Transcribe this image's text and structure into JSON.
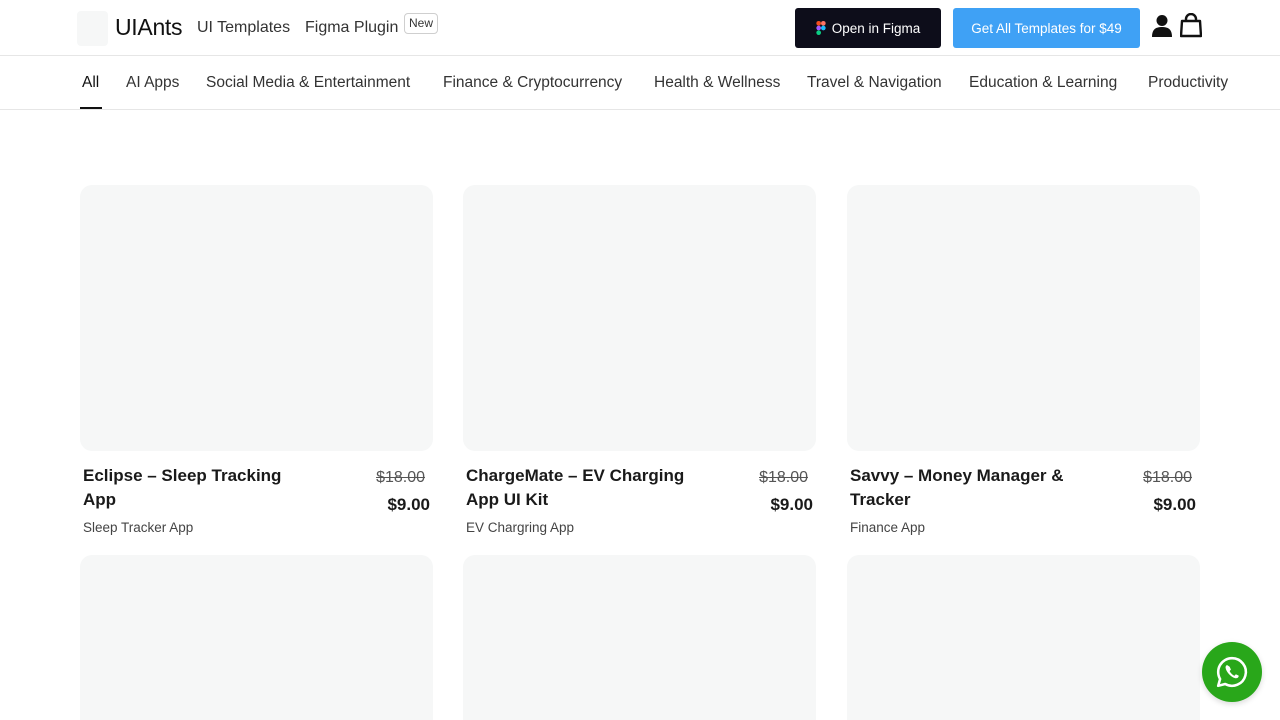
{
  "header": {
    "logo_text": "UIAnts",
    "nav_templates": "UI Templates",
    "nav_plugin": "Figma Plugin",
    "badge_new": "New",
    "btn_figma": "Open in Figma",
    "btn_all": "Get All Templates for $49"
  },
  "categories": [
    "All",
    "AI Apps",
    "Social Media & Entertainment",
    "Finance & Cryptocurrency",
    "Health & Wellness",
    "Travel & Navigation",
    "Education & Learning",
    "Productivity"
  ],
  "products": [
    {
      "title": "Eclipse – Sleep Tracking App",
      "old_price": "$18.00",
      "price": "$9.00",
      "category": "Sleep Tracker App"
    },
    {
      "title": "ChargeMate – EV Charging App UI Kit",
      "old_price": "$18.00",
      "price": "$9.00",
      "category": "EV Chargring App"
    },
    {
      "title": "Savvy – Money Manager & Tracker",
      "old_price": "$18.00",
      "price": "$9.00",
      "category": "Finance App"
    }
  ],
  "icons": {
    "figma": "figma-icon",
    "user": "user-icon",
    "cart": "shopping-bag-icon",
    "whatsapp": "whatsapp-icon"
  },
  "colors": {
    "primary_button": "#0d0d1a",
    "accent_button": "#3fa1f5",
    "whatsapp": "#29a71a",
    "placeholder": "#f6f7f7"
  }
}
